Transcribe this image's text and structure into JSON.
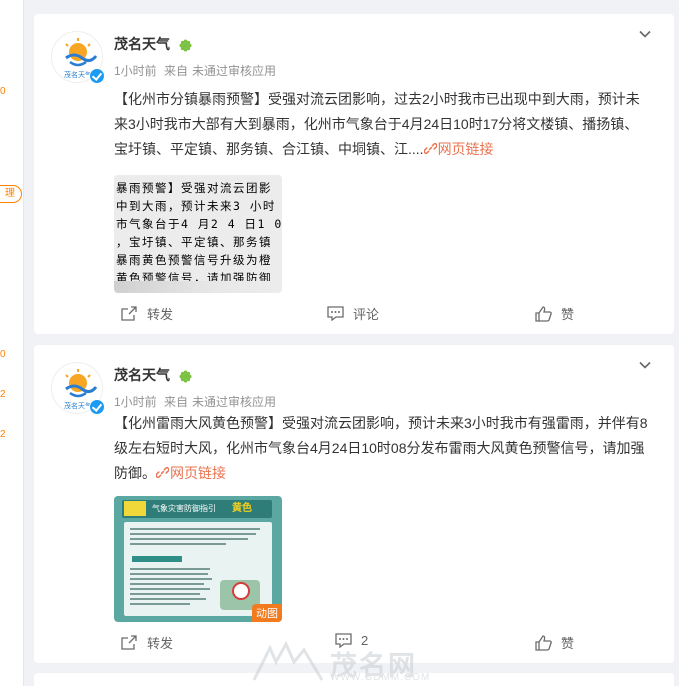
{
  "sidebar": {
    "marks": [
      "0",
      "0",
      "2",
      "2"
    ],
    "pill": "理"
  },
  "posts": [
    {
      "author": "茂名天气",
      "avatar_text": "茂名天气",
      "time": "1小时前",
      "source_prefix": "来自",
      "source": "未通过审核应用",
      "text": "【化州市分镇暴雨预警】受强对流云团影响，过去2小时我市已出现中到大雨，预计未来3小时我市大部有大到暴雨，化州市气象台于4月24日10时17分将文楼镇、播扬镇、宝圩镇、平定镇、那务镇、合江镇、中垌镇、江....",
      "link_label": "网页链接",
      "image_lines": [
        "暴雨预警】受强对流云团影",
        "中到大雨，预计未来3 小时",
        "市气象台于4 月2 4 日1 0",
        "，宝圩镇、平定镇、那务镇",
        "暴雨黄色预警信号升级为橙",
        "黄色预警信号，请加强防御"
      ],
      "repost_label": "转发",
      "comment_label": "评论",
      "like_label": "赞"
    },
    {
      "author": "茂名天气",
      "avatar_text": "茂名天气",
      "time": "1小时前",
      "source_prefix": "来自",
      "source": "未通过审核应用",
      "text": "【化州雷雨大风黄色预警】受强对流云团影响，预计未来3小时我市有强雷雨，并伴有8级左右短时大风，化州市气象台4月24日10时08分发布雷雨大风黄色预警信号，请加强防御。",
      "link_label": "网页链接",
      "image_title": "气象灾害防御指引",
      "image_badge": "黄色",
      "image_tag": "动图",
      "repost_label": "转发",
      "comment_label": "2",
      "like_label": "赞"
    }
  ],
  "watermark": {
    "text": "茂名网",
    "url": "WWW.GDMM.COM"
  },
  "colors": {
    "link": "#eb7350",
    "verified": "#1d9bf0",
    "vip": "#7cc242",
    "accent": "#ff8200"
  }
}
